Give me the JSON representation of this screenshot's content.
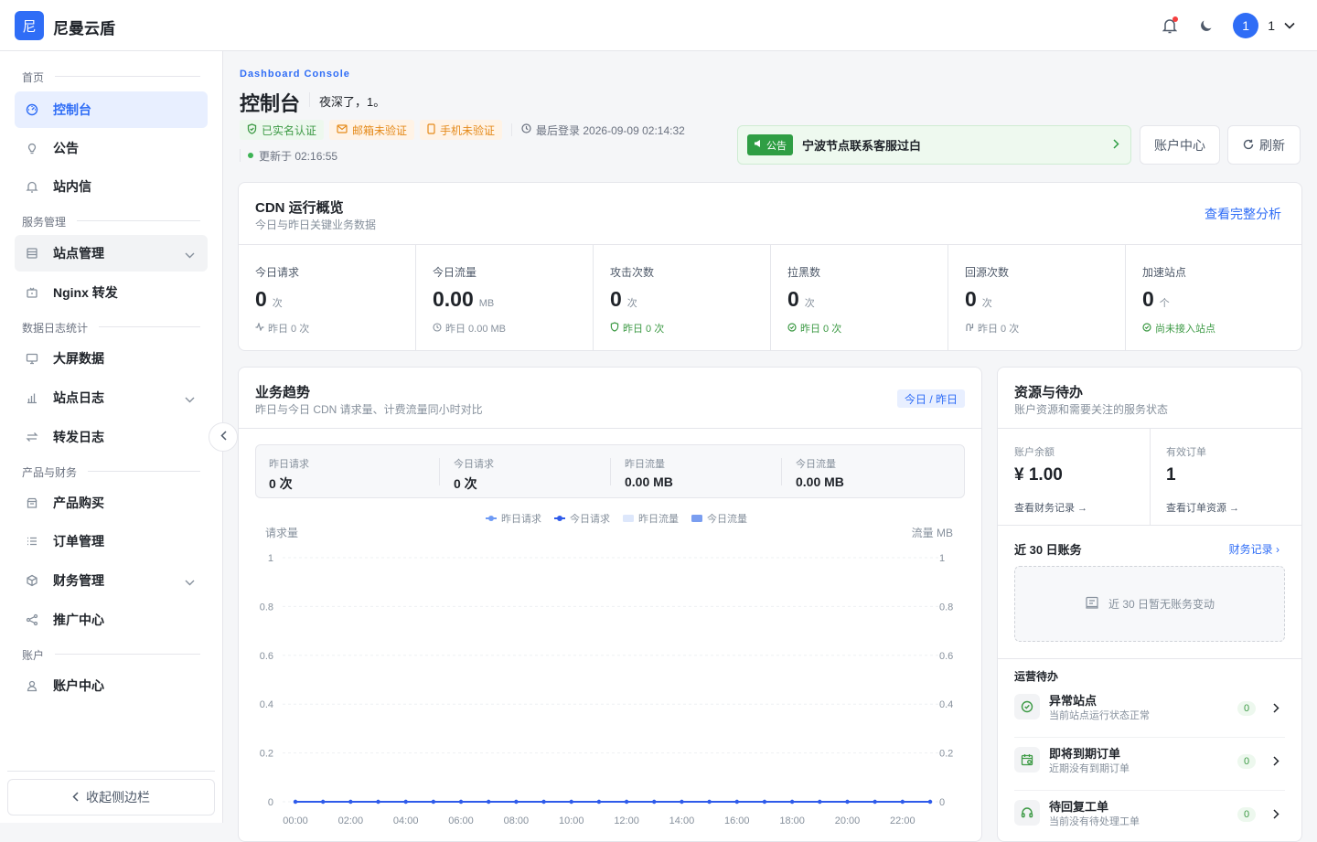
{
  "app": {
    "logo_char": "尼",
    "name": "尼曼云盾",
    "user_initial": "1",
    "user_name": "1",
    "brand_color": "#2f6df6"
  },
  "sidebar": {
    "sections": {
      "home": "首页",
      "service": "服务管理",
      "logs": "数据日志统计",
      "finance": "产品与财务",
      "account": "账户"
    },
    "items": [
      {
        "label": "控制台",
        "icon": "dashboard-icon"
      },
      {
        "label": "公告",
        "icon": "bulb-icon"
      },
      {
        "label": "站内信",
        "icon": "bell-icon"
      },
      {
        "label": "站点管理",
        "icon": "server-icon"
      },
      {
        "label": "Nginx 转发",
        "icon": "forward-icon"
      },
      {
        "label": "大屏数据",
        "icon": "monitor-icon"
      },
      {
        "label": "站点日志",
        "icon": "bar-chart-icon"
      },
      {
        "label": "转发日志",
        "icon": "swap-icon"
      },
      {
        "label": "产品购买",
        "icon": "store-icon"
      },
      {
        "label": "订单管理",
        "icon": "list-icon"
      },
      {
        "label": "财务管理",
        "icon": "cube-icon"
      },
      {
        "label": "推广中心",
        "icon": "share-icon"
      },
      {
        "label": "账户中心",
        "icon": "user-icon"
      }
    ],
    "collapse_label": "收起侧边栏"
  },
  "header": {
    "eyebrow": "Dashboard Console",
    "title": "控制台",
    "greeting": "夜深了，1。",
    "badges": {
      "verified": "已实名认证",
      "email": "邮箱未验证",
      "phone": "手机未验证"
    },
    "last_login": "最后登录 2026-09-09 02:14:32",
    "updated": "更新于 02:16:55",
    "notice_tag": "公告",
    "notice_text": "宁波节点联系客服过白",
    "account_btn": "账户中心",
    "refresh_btn": "刷新"
  },
  "overview": {
    "title": "CDN 运行概览",
    "subtitle": "今日与昨日关键业务数据",
    "link": "查看完整分析",
    "kpis": [
      {
        "label": "今日请求",
        "value": "0",
        "unit": "次",
        "foot": "昨日 0 次",
        "tone": "neutral"
      },
      {
        "label": "今日流量",
        "value": "0.00",
        "unit": "MB",
        "foot": "昨日 0.00 MB",
        "tone": "neutral"
      },
      {
        "label": "攻击次数",
        "value": "0",
        "unit": "次",
        "foot": "昨日 0 次",
        "tone": "good"
      },
      {
        "label": "拉黑数",
        "value": "0",
        "unit": "次",
        "foot": "昨日 0 次",
        "tone": "good"
      },
      {
        "label": "回源次数",
        "value": "0",
        "unit": "次",
        "foot": "昨日 0 次",
        "tone": "neutral"
      },
      {
        "label": "加速站点",
        "value": "0",
        "unit": "个",
        "foot": "尚未接入站点",
        "tone": "good"
      }
    ]
  },
  "trend": {
    "title": "业务趋势",
    "subtitle": "昨日与今日 CDN 请求量、计费流量同小时对比",
    "tag": "今日 / 昨日",
    "summary": [
      {
        "label": "昨日请求",
        "value": "0 次"
      },
      {
        "label": "今日请求",
        "value": "0 次"
      },
      {
        "label": "昨日流量",
        "value": "0.00 MB"
      },
      {
        "label": "今日流量",
        "value": "0.00 MB"
      }
    ]
  },
  "chart_data": {
    "type": "line",
    "xlabel": "",
    "ylabel": "请求量",
    "y2label": "流量 MB",
    "ylim": [
      0,
      1
    ],
    "y2lim": [
      0,
      1
    ],
    "yticks": [
      "0",
      "0.2",
      "0.4",
      "0.6",
      "0.8",
      "1"
    ],
    "y2ticks": [
      "0",
      "0.2",
      "0.4",
      "0.6",
      "0.8",
      "1"
    ],
    "legend_position": "top-center",
    "grid": true,
    "xticks": [
      "00:00",
      "02:00",
      "04:00",
      "06:00",
      "08:00",
      "10:00",
      "12:00",
      "14:00",
      "16:00",
      "18:00",
      "20:00",
      "22:00"
    ],
    "x": [
      0,
      1,
      2,
      3,
      4,
      5,
      6,
      7,
      8,
      9,
      10,
      11,
      12,
      13,
      14,
      15,
      16,
      17,
      18,
      19,
      20,
      21,
      22,
      23
    ],
    "series": [
      {
        "name": "昨日请求",
        "type": "line",
        "color": "#6f9bf5",
        "values": [
          0,
          0,
          0,
          0,
          0,
          0,
          0,
          0,
          0,
          0,
          0,
          0,
          0,
          0,
          0,
          0,
          0,
          0,
          0,
          0,
          0,
          0,
          0,
          0
        ]
      },
      {
        "name": "今日请求",
        "type": "line",
        "color": "#2f5bea",
        "values": [
          0,
          0,
          0,
          0,
          0,
          0,
          0,
          0,
          0,
          0,
          0,
          0,
          0,
          0,
          0,
          0,
          0,
          0,
          0,
          0,
          0,
          0,
          0,
          0
        ]
      },
      {
        "name": "昨日流量",
        "type": "bar",
        "color": "#dde7fb",
        "values": [
          0,
          0,
          0,
          0,
          0,
          0,
          0,
          0,
          0,
          0,
          0,
          0,
          0,
          0,
          0,
          0,
          0,
          0,
          0,
          0,
          0,
          0,
          0,
          0
        ]
      },
      {
        "name": "今日流量",
        "type": "bar",
        "color": "#7a9ef0",
        "values": [
          0,
          0,
          0,
          0,
          0,
          0,
          0,
          0,
          0,
          0,
          0,
          0,
          0,
          0,
          0,
          0,
          0,
          0,
          0,
          0,
          0,
          0,
          0,
          0
        ]
      }
    ]
  },
  "resources": {
    "title": "资源与待办",
    "subtitle": "账户资源和需要关注的服务状态",
    "balance_label": "账户余额",
    "balance_value": "¥ 1.00",
    "balance_link": "查看财务记录 →",
    "orders_label": "有效订单",
    "orders_value": "1",
    "orders_link": "查看订单资源 →",
    "bills_title": "近 30 日账务",
    "bills_link": "财务记录 ›",
    "bills_empty": "近 30 日暂无账务变动",
    "ops_title": "运营待办",
    "todos": [
      {
        "title": "异常站点",
        "sub": "当前站点运行状态正常",
        "count": "0"
      },
      {
        "title": "即将到期订单",
        "sub": "近期没有到期订单",
        "count": "0"
      },
      {
        "title": "待回复工单",
        "sub": "当前没有待处理工单",
        "count": "0"
      }
    ]
  }
}
